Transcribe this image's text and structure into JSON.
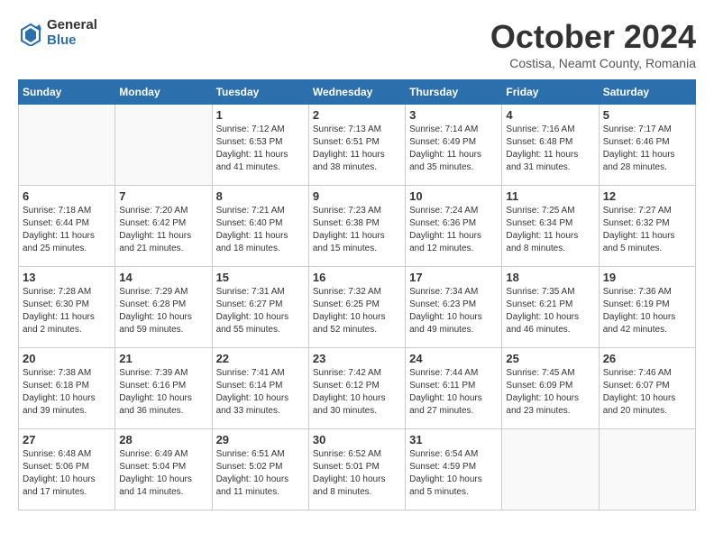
{
  "header": {
    "logo_general": "General",
    "logo_blue": "Blue",
    "title": "October 2024",
    "subtitle": "Costisa, Neamt County, Romania"
  },
  "weekdays": [
    "Sunday",
    "Monday",
    "Tuesday",
    "Wednesday",
    "Thursday",
    "Friday",
    "Saturday"
  ],
  "days": [
    {
      "num": "",
      "info": ""
    },
    {
      "num": "",
      "info": ""
    },
    {
      "num": "1",
      "info": "Sunrise: 7:12 AM\nSunset: 6:53 PM\nDaylight: 11 hours and 41 minutes."
    },
    {
      "num": "2",
      "info": "Sunrise: 7:13 AM\nSunset: 6:51 PM\nDaylight: 11 hours and 38 minutes."
    },
    {
      "num": "3",
      "info": "Sunrise: 7:14 AM\nSunset: 6:49 PM\nDaylight: 11 hours and 35 minutes."
    },
    {
      "num": "4",
      "info": "Sunrise: 7:16 AM\nSunset: 6:48 PM\nDaylight: 11 hours and 31 minutes."
    },
    {
      "num": "5",
      "info": "Sunrise: 7:17 AM\nSunset: 6:46 PM\nDaylight: 11 hours and 28 minutes."
    },
    {
      "num": "6",
      "info": "Sunrise: 7:18 AM\nSunset: 6:44 PM\nDaylight: 11 hours and 25 minutes."
    },
    {
      "num": "7",
      "info": "Sunrise: 7:20 AM\nSunset: 6:42 PM\nDaylight: 11 hours and 21 minutes."
    },
    {
      "num": "8",
      "info": "Sunrise: 7:21 AM\nSunset: 6:40 PM\nDaylight: 11 hours and 18 minutes."
    },
    {
      "num": "9",
      "info": "Sunrise: 7:23 AM\nSunset: 6:38 PM\nDaylight: 11 hours and 15 minutes."
    },
    {
      "num": "10",
      "info": "Sunrise: 7:24 AM\nSunset: 6:36 PM\nDaylight: 11 hours and 12 minutes."
    },
    {
      "num": "11",
      "info": "Sunrise: 7:25 AM\nSunset: 6:34 PM\nDaylight: 11 hours and 8 minutes."
    },
    {
      "num": "12",
      "info": "Sunrise: 7:27 AM\nSunset: 6:32 PM\nDaylight: 11 hours and 5 minutes."
    },
    {
      "num": "13",
      "info": "Sunrise: 7:28 AM\nSunset: 6:30 PM\nDaylight: 11 hours and 2 minutes."
    },
    {
      "num": "14",
      "info": "Sunrise: 7:29 AM\nSunset: 6:28 PM\nDaylight: 10 hours and 59 minutes."
    },
    {
      "num": "15",
      "info": "Sunrise: 7:31 AM\nSunset: 6:27 PM\nDaylight: 10 hours and 55 minutes."
    },
    {
      "num": "16",
      "info": "Sunrise: 7:32 AM\nSunset: 6:25 PM\nDaylight: 10 hours and 52 minutes."
    },
    {
      "num": "17",
      "info": "Sunrise: 7:34 AM\nSunset: 6:23 PM\nDaylight: 10 hours and 49 minutes."
    },
    {
      "num": "18",
      "info": "Sunrise: 7:35 AM\nSunset: 6:21 PM\nDaylight: 10 hours and 46 minutes."
    },
    {
      "num": "19",
      "info": "Sunrise: 7:36 AM\nSunset: 6:19 PM\nDaylight: 10 hours and 42 minutes."
    },
    {
      "num": "20",
      "info": "Sunrise: 7:38 AM\nSunset: 6:18 PM\nDaylight: 10 hours and 39 minutes."
    },
    {
      "num": "21",
      "info": "Sunrise: 7:39 AM\nSunset: 6:16 PM\nDaylight: 10 hours and 36 minutes."
    },
    {
      "num": "22",
      "info": "Sunrise: 7:41 AM\nSunset: 6:14 PM\nDaylight: 10 hours and 33 minutes."
    },
    {
      "num": "23",
      "info": "Sunrise: 7:42 AM\nSunset: 6:12 PM\nDaylight: 10 hours and 30 minutes."
    },
    {
      "num": "24",
      "info": "Sunrise: 7:44 AM\nSunset: 6:11 PM\nDaylight: 10 hours and 27 minutes."
    },
    {
      "num": "25",
      "info": "Sunrise: 7:45 AM\nSunset: 6:09 PM\nDaylight: 10 hours and 23 minutes."
    },
    {
      "num": "26",
      "info": "Sunrise: 7:46 AM\nSunset: 6:07 PM\nDaylight: 10 hours and 20 minutes."
    },
    {
      "num": "27",
      "info": "Sunrise: 6:48 AM\nSunset: 5:06 PM\nDaylight: 10 hours and 17 minutes."
    },
    {
      "num": "28",
      "info": "Sunrise: 6:49 AM\nSunset: 5:04 PM\nDaylight: 10 hours and 14 minutes."
    },
    {
      "num": "29",
      "info": "Sunrise: 6:51 AM\nSunset: 5:02 PM\nDaylight: 10 hours and 11 minutes."
    },
    {
      "num": "30",
      "info": "Sunrise: 6:52 AM\nSunset: 5:01 PM\nDaylight: 10 hours and 8 minutes."
    },
    {
      "num": "31",
      "info": "Sunrise: 6:54 AM\nSunset: 4:59 PM\nDaylight: 10 hours and 5 minutes."
    },
    {
      "num": "",
      "info": ""
    },
    {
      "num": "",
      "info": ""
    }
  ]
}
